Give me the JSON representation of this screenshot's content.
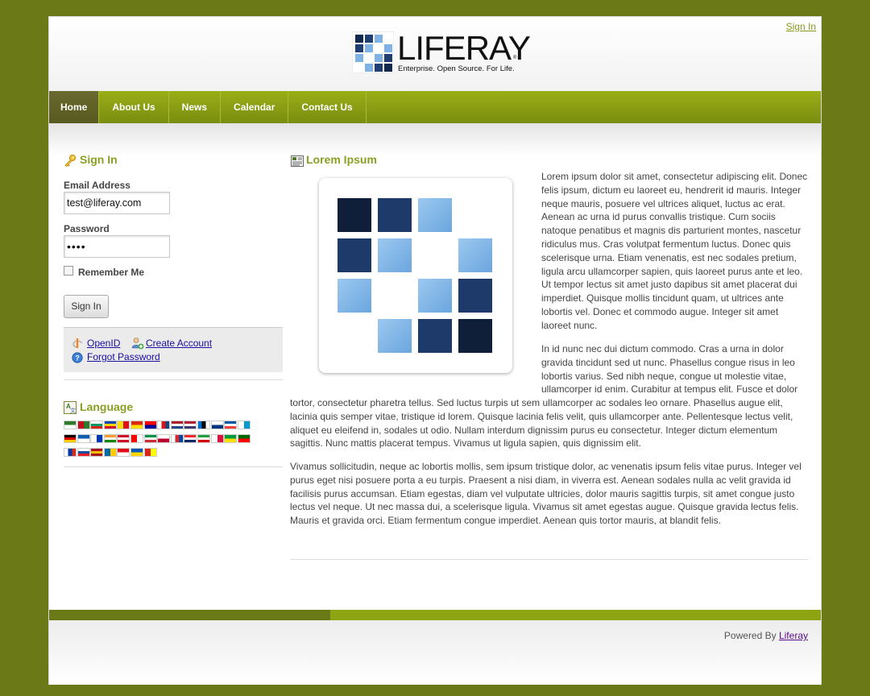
{
  "header": {
    "sign_in_link": "Sign In",
    "logo_text": "LIFERAY",
    "logo_tagline": "Enterprise. Open Source. For Life.",
    "logo_reg": "®"
  },
  "nav": {
    "items": [
      "Home",
      "About Us",
      "News",
      "Calendar",
      "Contact Us"
    ],
    "active": "Home"
  },
  "sign_in_portlet": {
    "title": "Sign In",
    "email_label": "Email Address",
    "email_value": "test@liferay.com",
    "password_label": "Password",
    "password_value": "••••",
    "remember_me": "Remember Me",
    "submit": "Sign In",
    "openid": "OpenID",
    "create_account": "Create Account",
    "forgot_password": "Forgot Password"
  },
  "language_portlet": {
    "title": "Language",
    "flag_count": 45
  },
  "content": {
    "title": "Lorem Ipsum",
    "paragraph1": "Lorem ipsum dolor sit amet, consectetur adipiscing elit. Donec felis ipsum, dictum eu laoreet eu, hendrerit id mauris. Integer neque mauris, posuere vel ultrices aliquet, luctus ac erat. Aenean ac urna id purus convallis tristique. Cum sociis natoque penatibus et magnis dis parturient montes, nascetur ridiculus mus. Cras volutpat fermentum luctus. Donec quis scelerisque urna. Etiam venenatis, est nec sodales pretium, ligula arcu ullamcorper sapien, quis laoreet purus ante et leo. Ut tempor lectus sit amet justo dapibus sit amet placerat dui imperdiet. Quisque mollis tincidunt quam, ut ultrices ante lobortis vel. Donec et commodo augue. Integer sit amet laoreet nunc.",
    "paragraph2_top": "In id nunc nec dui dictum commodo. Cras a urna in dolor gravida tincidunt sed ut nunc. Phasellus congue risus in leo lobortis varius. Sed nibh neque, congue ut molestie vitae, ullamcorper id enim. Curabitur at tempus elit. Fusce et dolor",
    "paragraph2_rest": "tortor, consectetur pharetra tellus. Sed luctus turpis ut sem ullamcorper ac sodales leo ornare. Phasellus augue elit, lacinia quis semper vitae, tristique id lorem. Quisque lacinia felis velit, quis ullamcorper ante. Pellentesque lectus velit, aliquet eu eleifend in, sodales ut odio. Nullam interdum dignissim purus eu consectetur. Integer dictum elementum sagittis. Nunc mattis placerat tempus. Vivamus ut ligula sapien, quis dignissim elit.",
    "paragraph3": "Vivamus sollicitudin, neque ac lobortis mollis, sem ipsum tristique dolor, ac venenatis ipsum felis vitae purus. Integer vel purus eget nisi posuere porta a eu turpis. Praesent a nisi diam, in viverra est. Aenean sodales nulla ac velit gravida id facilisis purus accumsan. Etiam egestas, diam vel vulputate ultricies, dolor mauris sagittis turpis, sit amet congue justo lectus vel neque. Ut nec massa dui, a scelerisque ligula. Vivamus sit amet egestas augue. Quisque gravida lectus felis. Mauris et gravida orci. Etiam fermentum congue imperdiet. Aenean quis tortor mauris, at blandit felis."
  },
  "footer": {
    "powered_by": "Powered By",
    "powered_link": "Liferay"
  },
  "colors": {
    "background": "#6b7a16",
    "nav": "#8fa413",
    "accent_title": "#8aa024",
    "link": "#1a0ea0"
  }
}
